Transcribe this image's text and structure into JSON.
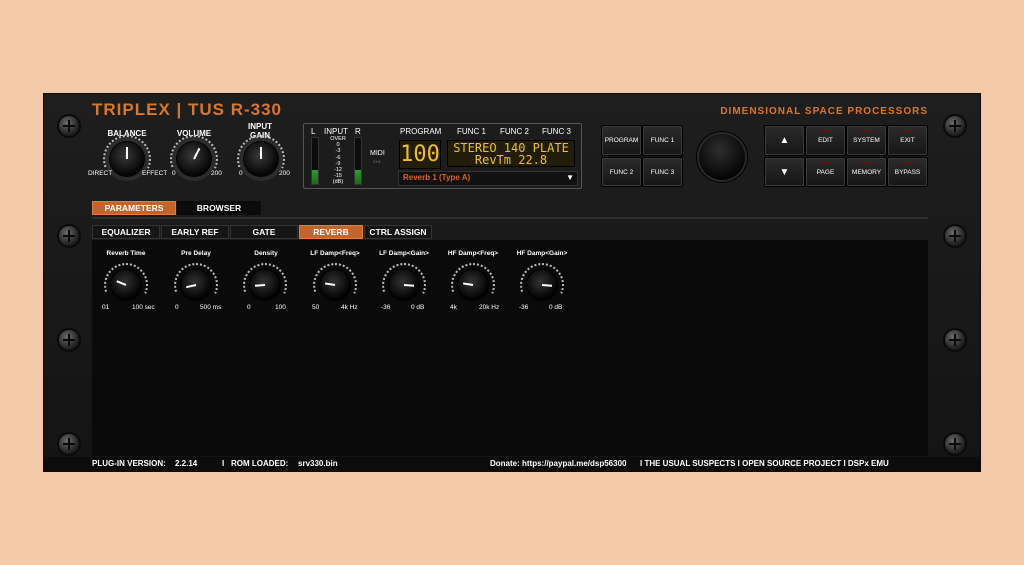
{
  "header": {
    "brand": "TRIPLEX | TUS R-330",
    "tagline": "DIMENSIONAL SPACE PROCESSORS"
  },
  "top_knobs": [
    {
      "title": "BALANCE",
      "min": "DIRECT",
      "max": "EFFECT",
      "value": 0.5
    },
    {
      "title": "VOLUME",
      "min": "0",
      "max": "200",
      "value": 0.6
    },
    {
      "title": "INPUT GAIN",
      "min": "0",
      "max": "200",
      "value": 0.5
    }
  ],
  "display": {
    "input_label": "INPUT",
    "left_ch": "L",
    "right_ch": "R",
    "meter_scale": [
      "OVER",
      "0",
      "-3",
      "-6",
      "-9",
      "-12",
      "-15",
      "(dB)"
    ],
    "midi_label": "MIDI",
    "midi_sub": "CH1",
    "program_label": "PROGRAM",
    "func1_label": "FUNC 1",
    "func2_label": "FUNC 2",
    "func3_label": "FUNC 3",
    "program_number": "100",
    "line1": "STEREO 140 PLATE",
    "line2": "RevTm  22.8",
    "preset": "Reverb 1 (Type A)"
  },
  "buttons_left": {
    "program": "PROGRAM",
    "func1": "FUNC 1",
    "func2": "FUNC 2",
    "func3": "FUNC 3"
  },
  "buttons_right": {
    "edit": "EDIT",
    "system": "SYSTEM",
    "exit": "EXIT",
    "page": "PAGE",
    "memory": "MEMORY",
    "bypass": "BYPASS",
    "up_icon": "arrow-up-icon",
    "down_icon": "arrow-down-icon"
  },
  "main_tabs": [
    "PARAMETERS",
    "BROWSER"
  ],
  "sub_tabs": [
    "EQUALIZER",
    "EARLY REF",
    "GATE",
    "REVERB",
    "CTRL ASSIGN"
  ],
  "params": [
    {
      "title": "Reverb Time",
      "min": "01",
      "max": "100 sec",
      "value": 0.25
    },
    {
      "title": "Pre Delay",
      "min": "0",
      "max": "500 ms",
      "value": 0.12
    },
    {
      "title": "Density",
      "min": "0",
      "max": "100",
      "value": 0.15
    },
    {
      "title": "LF Damp<Freq>",
      "min": "50",
      "max": "4k Hz",
      "value": 0.2
    },
    {
      "title": "LF Damp<Gain>",
      "min": "-36",
      "max": "0 dB",
      "value": 0.85
    },
    {
      "title": "HF Damp<Freq>",
      "min": "4k",
      "max": "20k Hz",
      "value": 0.2
    },
    {
      "title": "HF Damp<Gain>",
      "min": "-36",
      "max": "0 dB",
      "value": 0.85
    }
  ],
  "footer": {
    "version_label": "PLUG-IN VERSION:",
    "version": "2.2.14",
    "rom_label": "ROM LOADED:",
    "rom": "srv330.bin",
    "donate": "Donate: https://paypal.me/dsp56300",
    "links": "I  THE USUAL SUSPECTS  I  OPEN SOURCE PROJECT  I  DSPx EMU"
  },
  "colors": {
    "accent": "#d9782a",
    "lcd_text": "#f0c020",
    "preset_text": "#e06020",
    "tab_active": "#c4642a",
    "background": "#f3c9a8"
  }
}
